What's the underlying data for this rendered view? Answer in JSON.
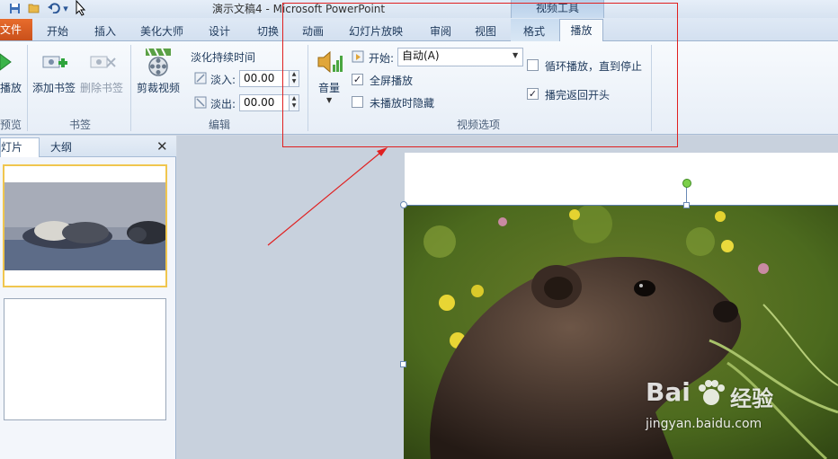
{
  "window": {
    "title": "演示文稿4  -  Microsoft PowerPoint",
    "contextual_group": "视频工具"
  },
  "tabs": {
    "file": "文件",
    "items": [
      "开始",
      "插入",
      "美化大师",
      "设计",
      "切换",
      "动画",
      "幻灯片放映",
      "审阅",
      "视图",
      "格式",
      "播放"
    ],
    "active": "播放"
  },
  "ribbon": {
    "preview": {
      "button_label": "播放",
      "group_label": "预览"
    },
    "bookmarks": {
      "add_label": "添加书签",
      "delete_label": "删除书签",
      "group_label": "书签"
    },
    "editing": {
      "trim_label": "剪裁视频",
      "fade_duration_label": "淡化持续时间",
      "fade_in_label": "淡入:",
      "fade_in_value": "00.00",
      "fade_out_label": "淡出:",
      "fade_out_value": "00.00",
      "group_label": "编辑"
    },
    "video_options": {
      "volume_label": "音量",
      "start_label": "开始:",
      "start_value": "自动(A)",
      "fullscreen_label": "全屏播放",
      "fullscreen_checked": true,
      "hide_label": "未播放时隐藏",
      "hide_checked": false,
      "loop_label": "循环播放，直到停止",
      "loop_checked": false,
      "rewind_label": "播完返回开头",
      "rewind_checked": true,
      "group_label": "视频选项"
    }
  },
  "left_pane": {
    "tab_slides": "幻灯片",
    "tab_outline": "大纲"
  },
  "watermark": {
    "brand": "Bai",
    "brand_cn": "经验",
    "url": "jingyan.baidu.com"
  },
  "colors": {
    "accent_orange": "#d45a1f",
    "annotation_red": "#e02020",
    "ribbon_bg": "#f3f7fc"
  }
}
